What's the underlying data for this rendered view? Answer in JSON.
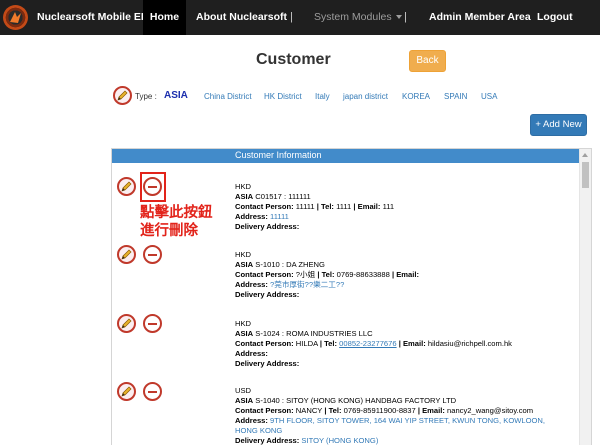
{
  "nav": {
    "brand": "Nuclearsoft Mobile ERP",
    "items": [
      {
        "label": "Home"
      },
      {
        "label": "About Nuclearsoft"
      },
      {
        "label": "|"
      },
      {
        "label": "System Modules"
      },
      {
        "label": "|"
      },
      {
        "label": "Admin Member Area"
      },
      {
        "label": "Logout"
      }
    ]
  },
  "page": {
    "title": "Customer",
    "back_label": "Back",
    "add_label": "+ Add New"
  },
  "types": {
    "label": "Type :",
    "active": "ASIA",
    "options": [
      "China District",
      "HK District",
      "Italy",
      "japan district",
      "KOREA",
      "SPAIN",
      "USA"
    ]
  },
  "table": {
    "header": "Customer Information"
  },
  "annotation": {
    "line1": "點擊此按鈕",
    "line2": "進行刪除"
  },
  "records": [
    {
      "currency": "HKD",
      "region": "ASIA",
      "code": "C01517 : 111111",
      "contact_label": "Contact Person:",
      "contact": "11111",
      "tel_label": "| Tel:",
      "tel": "1111",
      "email_label": "| Email:",
      "email": "111",
      "address_label": "Address:",
      "address": "11111",
      "delivery_label": "Delivery Address:",
      "delivery": ""
    },
    {
      "currency": "HKD",
      "region": "ASIA",
      "code": "S-1010 : DA ZHENG",
      "contact_label": "Contact Person:",
      "contact": "?小姐",
      "tel_label": "| Tel:",
      "tel": "0769-88633888",
      "email_label": "| Email:",
      "email": "",
      "address_label": "Address:",
      "address": "?莞市厚街??樂二工??",
      "delivery_label": "Delivery Address:",
      "delivery": ""
    },
    {
      "currency": "HKD",
      "region": "ASIA",
      "code": "S-1024 : ROMA INDUSTRIES LLC",
      "contact_label": "Contact Person:",
      "contact": "HILDA",
      "tel_label": "| Tel:",
      "tel": "00852-23277676",
      "email_label": "| Email:",
      "email": "hildasiu@richpell.com.hk",
      "address_label": "Address:",
      "address": "",
      "delivery_label": "Delivery Address:",
      "delivery": ""
    },
    {
      "currency": "USD",
      "region": "ASIA",
      "code": "S-1040 : SITOY (HONG KONG) HANDBAG FACTORY LTD",
      "contact_label": "Contact Person:",
      "contact": "NANCY",
      "tel_label": "| Tel:",
      "tel": "0769-85911900-8837",
      "email_label": "| Email:",
      "email": "nancy2_wang@sitoy.com",
      "address_label": "Address:",
      "address": "9TH FLOOR, SITOY TOWER, 164 WAI YIP STREET, KWUN TONG, KOWLOON,",
      "address2": "HONG KONG",
      "delivery_label": "Delivery Address:",
      "delivery": "SITOY (HONG KONG)"
    }
  ]
}
